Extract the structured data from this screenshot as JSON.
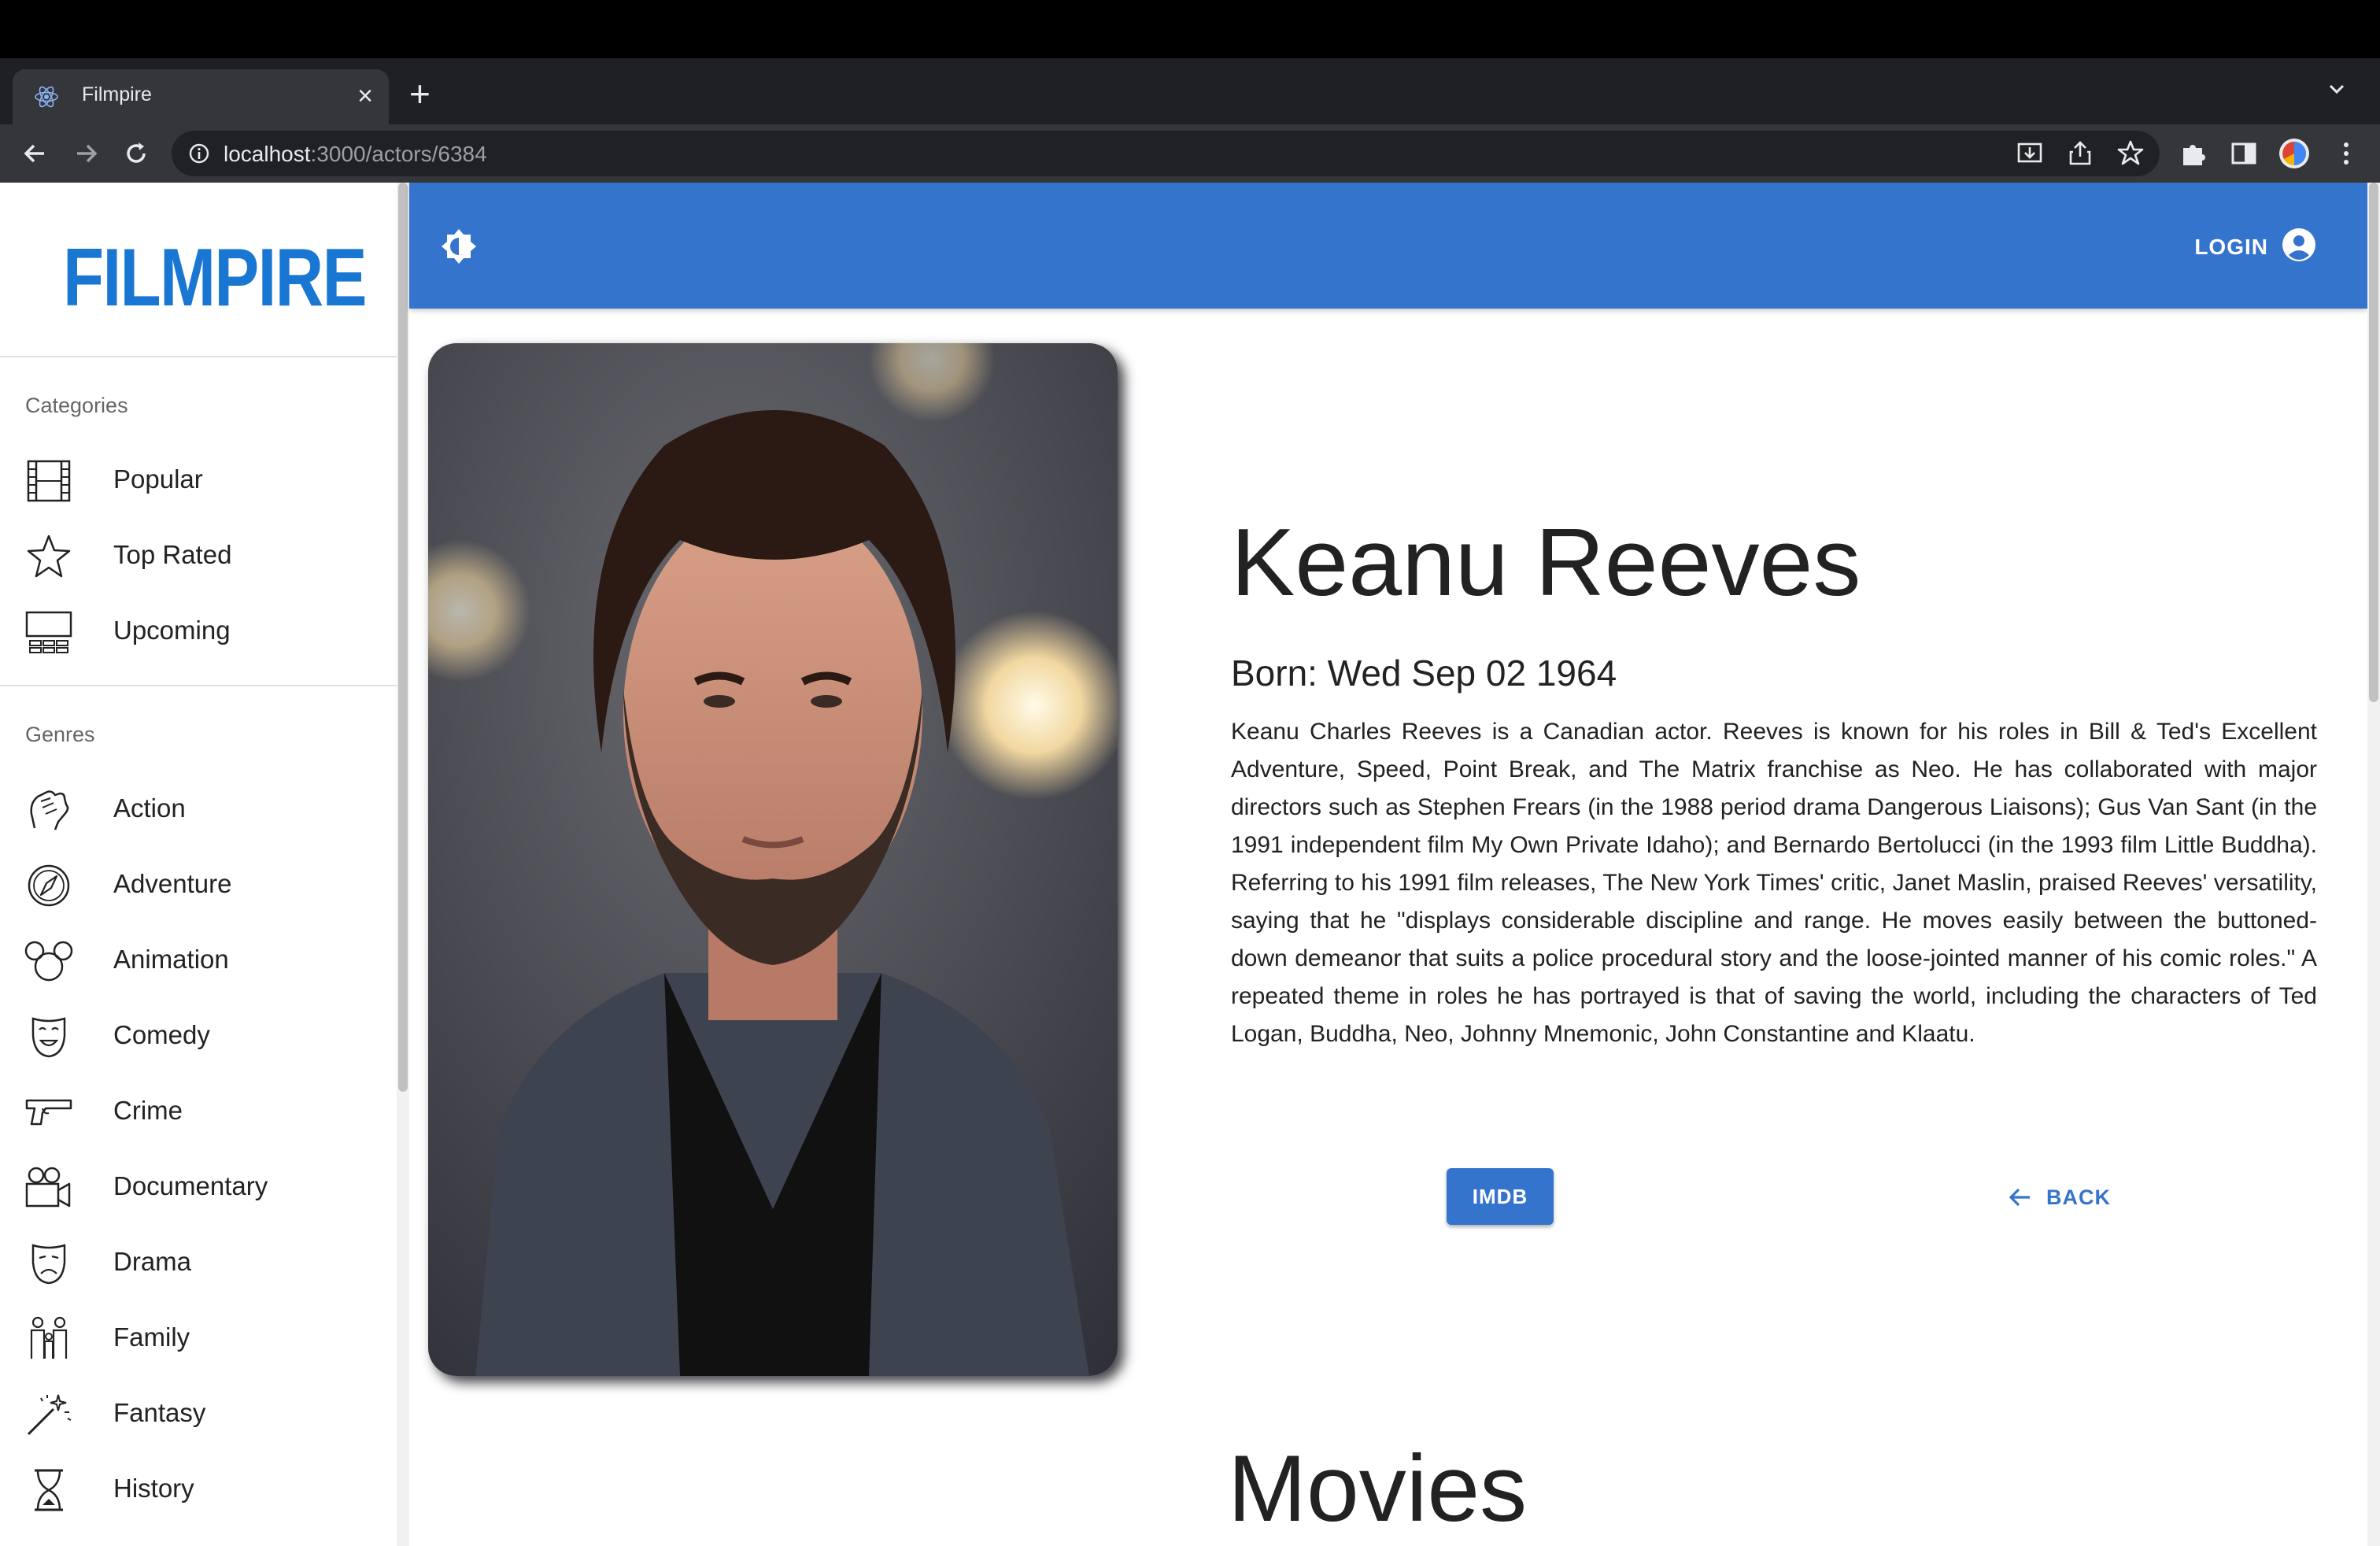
{
  "browser": {
    "tab_title": "Filmpire",
    "new_tab_symbol": "+",
    "close_symbol": "×",
    "url_host": "localhost",
    "url_path": ":3000/actors/6384"
  },
  "sidebar": {
    "logo_text": "FILMPIRE",
    "categories_header": "Categories",
    "categories": [
      {
        "label": "Popular",
        "icon": "film-strip-icon"
      },
      {
        "label": "Top Rated",
        "icon": "star-icon"
      },
      {
        "label": "Upcoming",
        "icon": "cinema-screen-icon"
      }
    ],
    "genres_header": "Genres",
    "genres": [
      {
        "label": "Action",
        "icon": "fist-icon"
      },
      {
        "label": "Adventure",
        "icon": "compass-icon"
      },
      {
        "label": "Animation",
        "icon": "mouse-ears-icon"
      },
      {
        "label": "Comedy",
        "icon": "comedy-mask-icon"
      },
      {
        "label": "Crime",
        "icon": "pistol-icon"
      },
      {
        "label": "Documentary",
        "icon": "movie-camera-icon"
      },
      {
        "label": "Drama",
        "icon": "drama-mask-icon"
      },
      {
        "label": "Family",
        "icon": "family-icon"
      },
      {
        "label": "Fantasy",
        "icon": "magic-wand-icon"
      },
      {
        "label": "History",
        "icon": "hourglass-icon"
      }
    ]
  },
  "appbar": {
    "login_label": "LOGIN"
  },
  "actor": {
    "name": "Keanu Reeves",
    "born": "Born: Wed Sep 02 1964",
    "biography": "Keanu Charles Reeves is a Canadian actor. Reeves is known for his roles in Bill & Ted's Excellent Adventure, Speed, Point Break, and The Matrix franchise as Neo. He has collaborated with major directors such as Stephen Frears (in the 1988 period drama Dangerous Liaisons); Gus Van Sant (in the 1991 independent film My Own Private Idaho); and Bernardo Bertolucci (in the 1993 film Little Buddha). Referring to his 1991 film releases, The New York Times' critic, Janet Maslin, praised Reeves' versatility, saying that he \"displays considerable discipline and range. He moves easily between the buttoned-down demeanor that suits a police procedural story and the loose-jointed manner of his comic roles.\" A repeated theme in roles he has portrayed is that of saving the world, including the characters of Ted Logan, Buddha, Neo, Johnny Mnemonic, John Constantine and Klaatu.",
    "imdb_label": "IMDB",
    "back_label": "BACK"
  },
  "movies_heading": "Movies",
  "colors": {
    "primary": "#3574cc",
    "logo": "#1976d2",
    "chrome_dark": "#35363a"
  }
}
